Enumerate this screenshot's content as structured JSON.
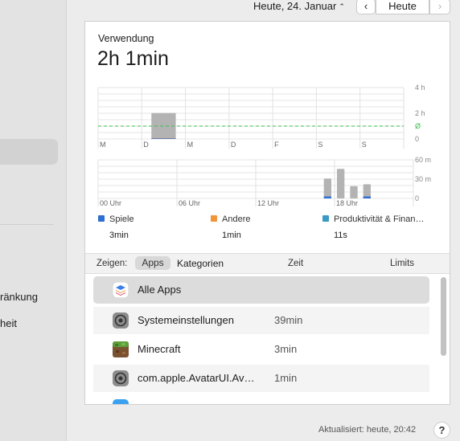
{
  "sidebar": {
    "items": [
      {
        "label": "ränkung"
      },
      {
        "label": "heit"
      }
    ]
  },
  "datebar": {
    "date_label": "Heute, 24. Januar",
    "today_button": "Heute",
    "prev_glyph": "‹",
    "next_glyph": "›"
  },
  "usage": {
    "label": "Verwendung",
    "total": "2h 1min"
  },
  "chart_data": [
    {
      "type": "bar",
      "categories": [
        "M",
        "D",
        "M",
        "D",
        "F",
        "S",
        "S"
      ],
      "y_ticks": [
        "4 h",
        "2 h",
        "Ø",
        "0"
      ],
      "ylim": [
        0,
        4
      ],
      "average": 1,
      "series": [
        {
          "name": "Spiele",
          "color": "#2f6fd1",
          "values": [
            0,
            0.05,
            0,
            0,
            0,
            0,
            0
          ]
        },
        {
          "name": "Andere",
          "color": "#f0953a",
          "values": [
            0,
            0.02,
            0,
            0,
            0,
            0,
            0
          ]
        },
        {
          "name": "Produktivität & Finan…",
          "color": "#3a9ac6",
          "values": [
            0,
            0,
            0,
            0,
            0,
            0,
            0
          ]
        },
        {
          "name": "total",
          "color": "#b3b3b3",
          "values": [
            0,
            2.02,
            0,
            0,
            0,
            0,
            0
          ]
        }
      ]
    },
    {
      "type": "bar",
      "x_ticks": [
        "00 Uhr",
        "06 Uhr",
        "12 Uhr",
        "18 Uhr"
      ],
      "y_ticks": [
        "60 m",
        "30 m",
        "0"
      ],
      "ylim": [
        0,
        60
      ],
      "hours": [
        17,
        18,
        19,
        20
      ],
      "series": [
        {
          "name": "total",
          "color": "#b3b3b3",
          "values": [
            31,
            46,
            19,
            22
          ]
        },
        {
          "name": "Spiele",
          "color": "#2f6fd1",
          "values": [
            3,
            0,
            0,
            3
          ]
        }
      ]
    }
  ],
  "legend": [
    {
      "name": "Spiele",
      "color": "#2f6fd1",
      "value": "3min"
    },
    {
      "name": "Andere",
      "color": "#f0953a",
      "value": "1min"
    },
    {
      "name": "Produktivität & Finan…",
      "color": "#3a9ac6",
      "value": "11s"
    }
  ],
  "tabs": {
    "show_label": "Zeigen:",
    "apps": "Apps",
    "categories": "Kategorien",
    "col_time": "Zeit",
    "col_limits": "Limits"
  },
  "apps": [
    {
      "name": "Alle Apps",
      "time": "",
      "icon": "stack-icon"
    },
    {
      "name": "Systemeinstellungen",
      "time": "39min",
      "icon": "gear-icon"
    },
    {
      "name": "Minecraft",
      "time": "3min",
      "icon": "minecraft-icon"
    },
    {
      "name": "com.apple.AvatarUI.Av…",
      "time": "1min",
      "icon": "gear-icon"
    }
  ],
  "footer": {
    "updated": "Aktualisiert: heute, 20:42",
    "help": "?"
  }
}
